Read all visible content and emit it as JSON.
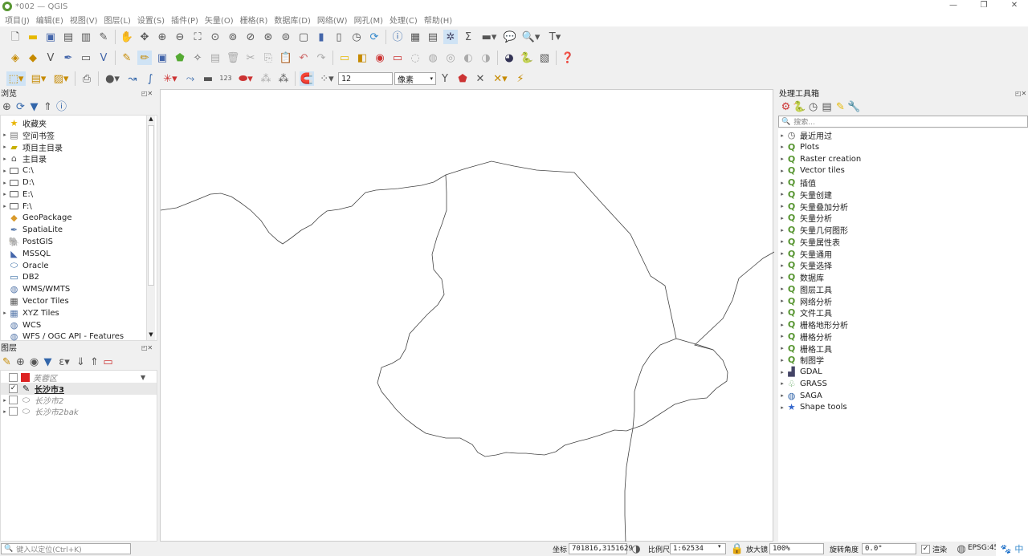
{
  "window": {
    "title": "*002 — QGIS",
    "min": "—",
    "max": "❐",
    "close": "✕"
  },
  "menu": [
    "项目(J)",
    "编辑(E)",
    "视图(V)",
    "图层(L)",
    "设置(S)",
    "插件(P)",
    "矢量(O)",
    "栅格(R)",
    "数据库(D)",
    "网络(W)",
    "网孔(M)",
    "处理(C)",
    "帮助(H)"
  ],
  "snap": {
    "tolerance": "12",
    "unit": "像素"
  },
  "browser": {
    "title": "浏览",
    "items": [
      {
        "label": "收藏夹",
        "icon": "star-icon",
        "glyph": "★",
        "color": "#e8b400",
        "expand": false
      },
      {
        "label": "空间书签",
        "icon": "bookmark-icon",
        "glyph": "▤",
        "color": "#777",
        "expand": true
      },
      {
        "label": "项目主目录",
        "icon": "folder-icon",
        "glyph": "▰",
        "color": "#c8b000",
        "expand": true
      },
      {
        "label": "主目录",
        "icon": "home-icon",
        "glyph": "⌂",
        "color": "#555",
        "expand": true
      },
      {
        "label": "C:\\",
        "icon": "folder-icon",
        "glyph": "",
        "color": "#666",
        "expand": true
      },
      {
        "label": "D:\\",
        "icon": "folder-icon",
        "glyph": "",
        "color": "#666",
        "expand": true
      },
      {
        "label": "E:\\",
        "icon": "folder-icon",
        "glyph": "",
        "color": "#666",
        "expand": true
      },
      {
        "label": "F:\\",
        "icon": "folder-icon",
        "glyph": "",
        "color": "#666",
        "expand": true
      },
      {
        "label": "GeoPackage",
        "icon": "geopackage-icon",
        "glyph": "◆",
        "color": "#d99a2b",
        "expand": false
      },
      {
        "label": "SpatiaLite",
        "icon": "spatialite-icon",
        "glyph": "✒",
        "color": "#5577aa",
        "expand": false
      },
      {
        "label": "PostGIS",
        "icon": "postgis-icon",
        "glyph": "🐘",
        "color": "#336791",
        "expand": false
      },
      {
        "label": "MSSQL",
        "icon": "mssql-icon",
        "glyph": "◣",
        "color": "#4466aa",
        "expand": false
      },
      {
        "label": "Oracle",
        "icon": "oracle-icon",
        "glyph": "⬭",
        "color": "#3a6ea5",
        "expand": false
      },
      {
        "label": "DB2",
        "icon": "db2-icon",
        "glyph": "▭",
        "color": "#3a6ea5",
        "expand": false
      },
      {
        "label": "WMS/WMTS",
        "icon": "wms-icon",
        "glyph": "◍",
        "color": "#5577aa",
        "expand": false
      },
      {
        "label": "Vector Tiles",
        "icon": "vector-tiles-icon",
        "glyph": "▦",
        "color": "#555",
        "expand": false
      },
      {
        "label": "XYZ Tiles",
        "icon": "xyz-tiles-icon",
        "glyph": "▦",
        "color": "#5577aa",
        "expand": true
      },
      {
        "label": "WCS",
        "icon": "wcs-icon",
        "glyph": "◍",
        "color": "#5577aa",
        "expand": false
      },
      {
        "label": "WFS / OGC API - Features",
        "icon": "wfs-icon",
        "glyph": "◍",
        "color": "#5577aa",
        "expand": false
      }
    ]
  },
  "layers": {
    "title": "图层",
    "items": [
      {
        "label": "芙蓉区",
        "checked": false,
        "swatch": "#dd2222",
        "bold": false,
        "italic": true,
        "grey": true,
        "expand": false,
        "filter": true
      },
      {
        "label": "长沙市3",
        "checked": true,
        "swatch": "edit",
        "bold": true,
        "italic": false,
        "grey": false,
        "expand": false,
        "filter": false
      },
      {
        "label": "长沙市2",
        "checked": false,
        "swatch": "poly",
        "bold": false,
        "italic": true,
        "grey": true,
        "expand": true,
        "filter": false
      },
      {
        "label": "长沙市2bak",
        "checked": false,
        "swatch": "poly",
        "bold": false,
        "italic": true,
        "grey": true,
        "expand": true,
        "filter": false
      }
    ]
  },
  "toolbox": {
    "title": "处理工具箱",
    "search_placeholder": "搜索...",
    "items": [
      {
        "label": "最近用过",
        "icon": "clock-icon"
      },
      {
        "label": "Plots",
        "icon": "qgis-icon"
      },
      {
        "label": "Raster creation",
        "icon": "qgis-icon"
      },
      {
        "label": "Vector tiles",
        "icon": "qgis-icon"
      },
      {
        "label": "插值",
        "icon": "qgis-icon"
      },
      {
        "label": "矢量创建",
        "icon": "qgis-icon"
      },
      {
        "label": "矢量叠加分析",
        "icon": "qgis-icon"
      },
      {
        "label": "矢量分析",
        "icon": "qgis-icon"
      },
      {
        "label": "矢量几何图形",
        "icon": "qgis-icon"
      },
      {
        "label": "矢量属性表",
        "icon": "qgis-icon"
      },
      {
        "label": "矢量通用",
        "icon": "qgis-icon"
      },
      {
        "label": "矢量选择",
        "icon": "qgis-icon"
      },
      {
        "label": "数据库",
        "icon": "qgis-icon"
      },
      {
        "label": "图层工具",
        "icon": "qgis-icon"
      },
      {
        "label": "网络分析",
        "icon": "qgis-icon"
      },
      {
        "label": "文件工具",
        "icon": "qgis-icon"
      },
      {
        "label": "栅格地形分析",
        "icon": "qgis-icon"
      },
      {
        "label": "栅格分析",
        "icon": "qgis-icon"
      },
      {
        "label": "栅格工具",
        "icon": "qgis-icon"
      },
      {
        "label": "制图学",
        "icon": "qgis-icon"
      },
      {
        "label": "GDAL",
        "icon": "gdal-icon"
      },
      {
        "label": "GRASS",
        "icon": "grass-icon"
      },
      {
        "label": "SAGA",
        "icon": "saga-icon"
      },
      {
        "label": "Shape tools",
        "icon": "shape-tools-icon"
      }
    ]
  },
  "status": {
    "locator_placeholder": "键入以定位(Ctrl+K)",
    "coord_label": "坐标",
    "coord": "701816,3151629",
    "scale_label": "比例尺",
    "scale": "1:62534",
    "magnifier_label": "放大镜",
    "magnifier": "100%",
    "rotation_label": "旋转角度",
    "rotation": "0.0°",
    "render_label": "渲染",
    "crs": "EPSG:45",
    "ime": "中"
  }
}
